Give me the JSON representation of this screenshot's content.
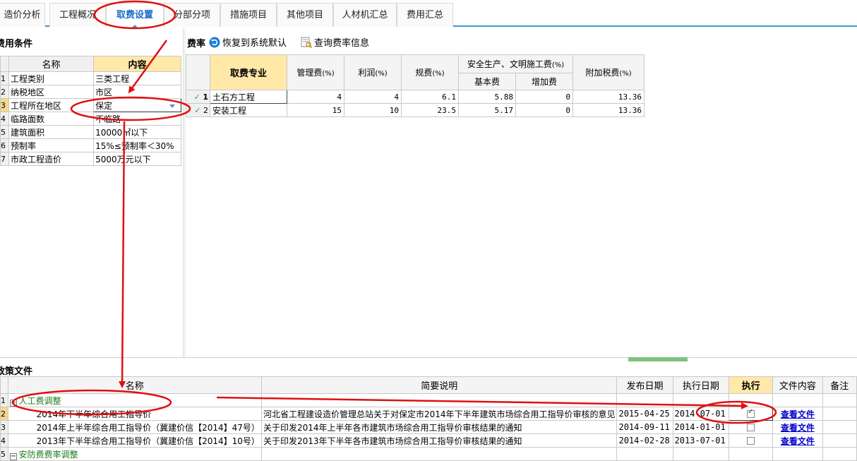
{
  "tabs": [
    {
      "label": "造价分析"
    },
    {
      "label": "工程概况"
    },
    {
      "label": "取费设置"
    },
    {
      "label": "分部分项"
    },
    {
      "label": "措施项目"
    },
    {
      "label": "其他项目"
    },
    {
      "label": "人材机汇总"
    },
    {
      "label": "费用汇总"
    }
  ],
  "left": {
    "title": "费用条件",
    "headers": {
      "name": "名称",
      "content": "内容"
    },
    "rows": [
      {
        "no": "1",
        "name": "工程类别",
        "value": "三类工程"
      },
      {
        "no": "2",
        "name": "纳税地区",
        "value": "市区"
      },
      {
        "no": "3",
        "name": "工程所在地区",
        "value": "保定"
      },
      {
        "no": "4",
        "name": "临路面数",
        "value": "不临路"
      },
      {
        "no": "5",
        "name": "建筑面积",
        "value": "10000㎡以下"
      },
      {
        "no": "6",
        "name": "预制率",
        "value": "15%≤预制率＜30%"
      },
      {
        "no": "7",
        "name": "市政工程造价",
        "value": "5000万元以下"
      }
    ]
  },
  "rate": {
    "title": "费率",
    "restore_label": "恢复到系统默认",
    "query_label": "查询费率信息",
    "headers": {
      "specialty": "取费专业",
      "mgmt": "管理费",
      "profit": "利润",
      "fees": "规费",
      "safety": "安全生产、文明施工费",
      "base": "基本费",
      "extra": "增加费",
      "tax": "附加税费",
      "unit": "(%)"
    },
    "rows": [
      {
        "no": "1",
        "specialty": "土石方工程",
        "mgmt": "4",
        "profit": "4",
        "fees": "6.1",
        "base": "5.88",
        "extra": "0",
        "tax": "13.36"
      },
      {
        "no": "2",
        "specialty": "安装工程",
        "mgmt": "15",
        "profit": "10",
        "fees": "23.5",
        "base": "5.17",
        "extra": "0",
        "tax": "13.36"
      }
    ]
  },
  "policy": {
    "title": "政策文件",
    "headers": {
      "name": "名称",
      "desc": "简要说明",
      "publish": "发布日期",
      "exec_date": "执行日期",
      "exec": "执行",
      "file": "文件内容",
      "note": "备注"
    },
    "rows": [
      {
        "no": "1",
        "type": "group",
        "name": "人工费调整"
      },
      {
        "no": "2",
        "type": "item",
        "name": "2014年下半年综合用工指导价",
        "desc": "河北省工程建设造价管理总站关于对保定市2014年下半年建筑市场综合用工指导价审核的意见",
        "publish": "2015-04-25",
        "exec_date": "2014-07-01",
        "checked": true,
        "file": "查看文件"
      },
      {
        "no": "3",
        "type": "item",
        "name": "2014年上半年综合用工指导价（冀建价信【2014】47号）",
        "desc": "关于印发2014年上半年各市建筑市场综合用工指导价审核结果的通知",
        "publish": "2014-09-11",
        "exec_date": "2014-01-01",
        "checked": false,
        "file": "查看文件"
      },
      {
        "no": "4",
        "type": "item",
        "name": "2013年下半年综合用工指导价（冀建价信【2014】10号）",
        "desc": "关于印发2013年下半年各市建筑市场综合用工指导价审核结果的通知",
        "publish": "2014-02-28",
        "exec_date": "2013-07-01",
        "checked": false,
        "file": "查看文件"
      },
      {
        "no": "5",
        "type": "group",
        "name": "安防费费率调整"
      }
    ]
  },
  "colors": {
    "accent": "#3d9bd1",
    "header_highlight": "#ffe8a8",
    "annotation": "#e01010",
    "group_text": "#1b7a1b",
    "link": "#0000cc"
  }
}
